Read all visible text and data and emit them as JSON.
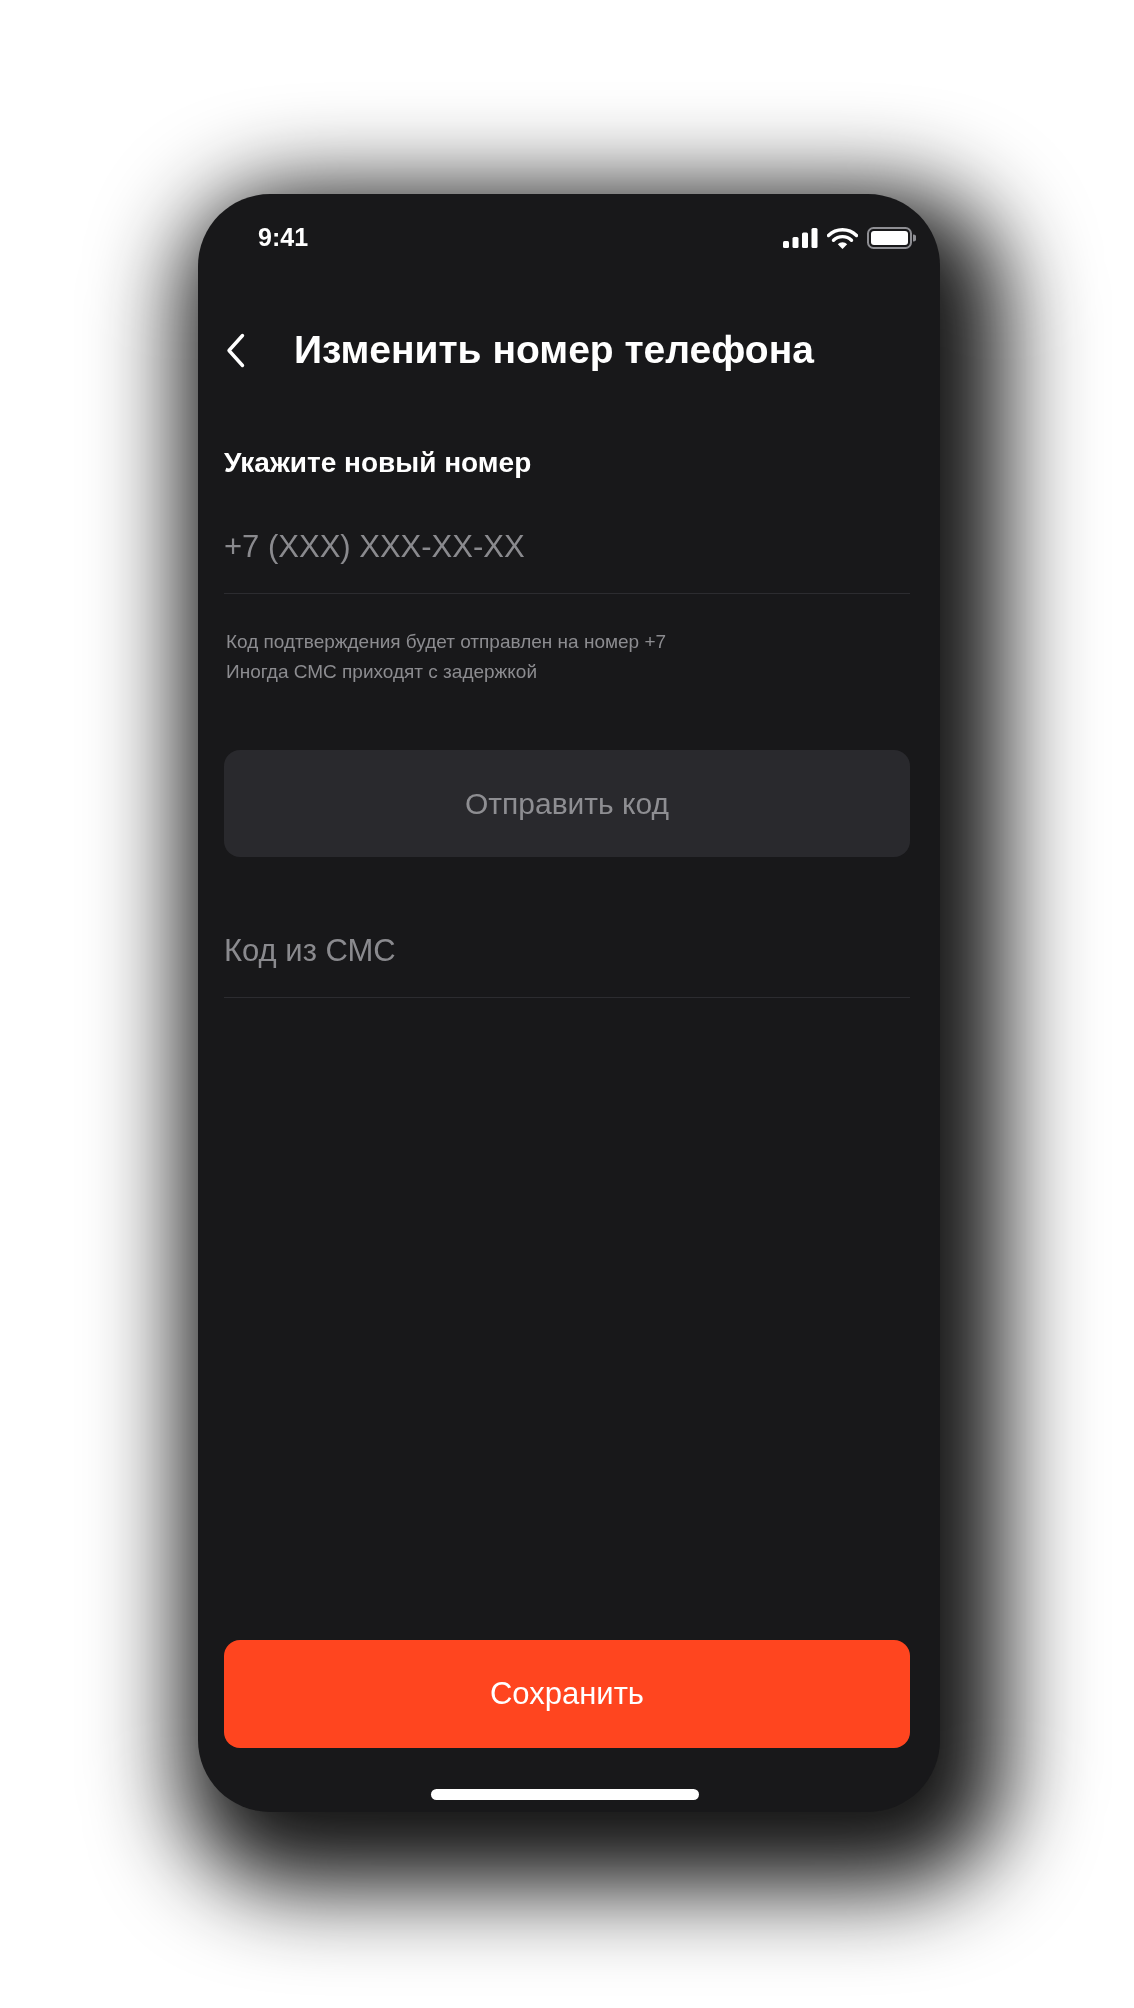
{
  "status_bar": {
    "time": "9:41"
  },
  "header": {
    "title": "Изменить номер телефона"
  },
  "phone_section": {
    "label": "Укажите новый номер",
    "phone_field": {
      "placeholder": "+7 (XXX) XXX-XX-XX"
    },
    "hint_lines": [
      "Код подтверждения будет отправлен на номер +7",
      "Иногда СМС приходят с задержкой"
    ]
  },
  "send_code_button": {
    "label": "Отправить код",
    "disabled": true
  },
  "sms_code_field": {
    "placeholder": "Код из СМС"
  },
  "save_button": {
    "label": "Сохранить"
  }
}
